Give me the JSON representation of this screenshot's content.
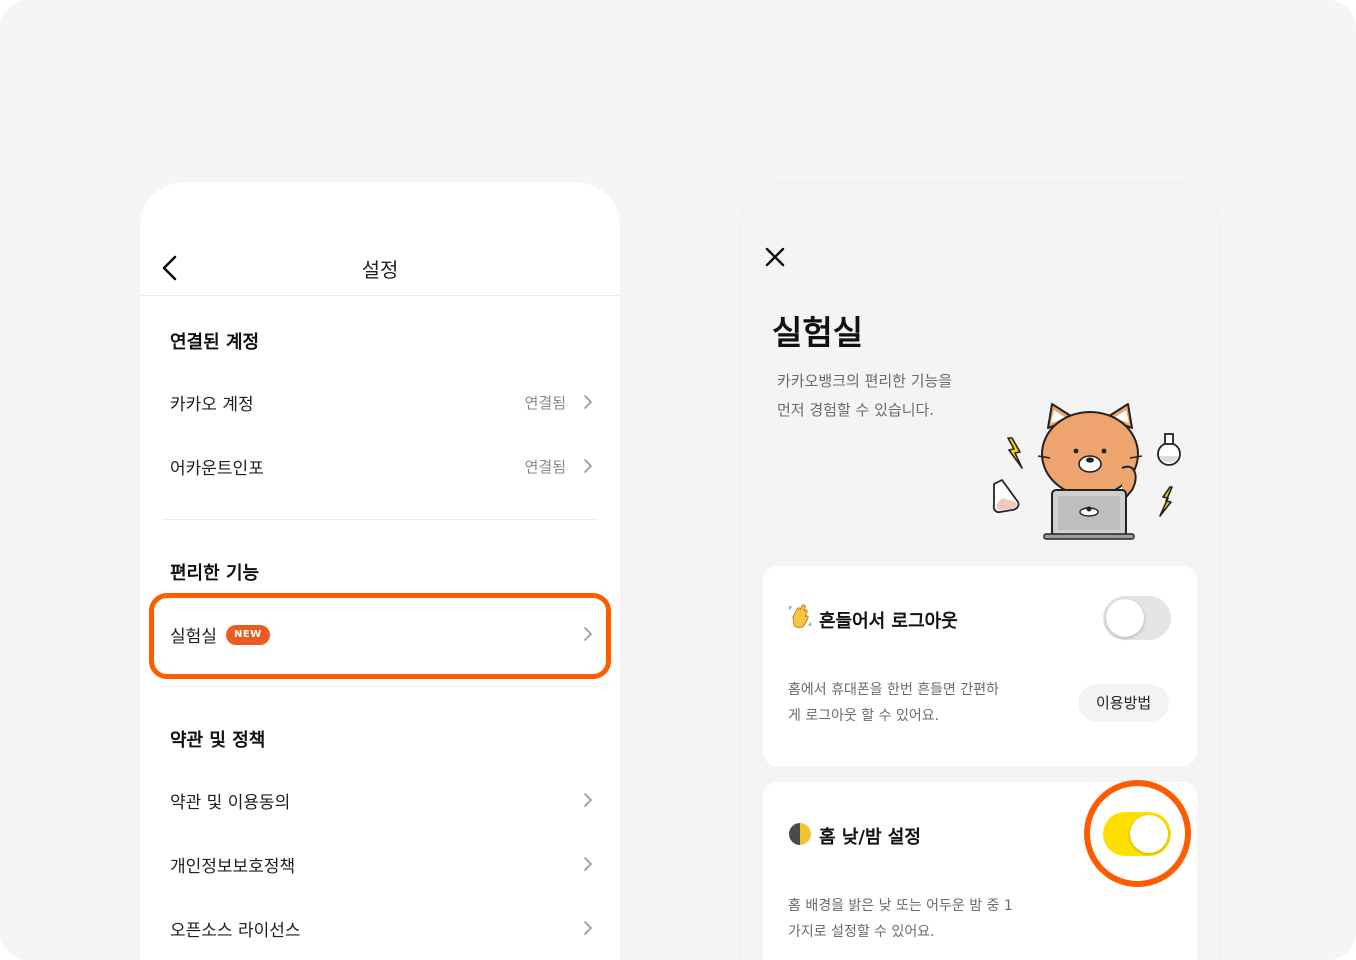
{
  "settings": {
    "nav_title": "설정",
    "sections": {
      "accounts": {
        "title": "연결된 계정",
        "items": [
          {
            "label": "카카오 계정",
            "value": "연결됨"
          },
          {
            "label": "어카운트인포",
            "value": "연결됨"
          }
        ]
      },
      "features": {
        "title": "편리한 기능",
        "items": [
          {
            "label": "실험실",
            "badge": "NEW"
          }
        ]
      },
      "policies": {
        "title": "약관 및 정책",
        "items": [
          {
            "label": "약관 및 이용동의"
          },
          {
            "label": "개인정보보호정책"
          },
          {
            "label": "오픈소스 라이선스"
          }
        ]
      }
    }
  },
  "lab": {
    "title": "실험실",
    "description_line1": "카카오뱅크의 편리한 기능을",
    "description_line2": "먼저 경험할 수 있습니다.",
    "features": [
      {
        "icon": "waving-hand-icon",
        "title": "흔들어서 로그아웃",
        "desc_line1": "홈에서 휴대폰을 한번 흔들면 간편하",
        "desc_line2": "게 로그아웃 할 수 있어요.",
        "toggle_on": false,
        "button_label": "이용방법"
      },
      {
        "icon": "half-moon-icon",
        "title": "홈 낮/밤 설정",
        "desc_line1": "홈 배경을 밝은 낮 또는 어두운 밤 중 1",
        "desc_line2": "가지로 설정할 수 있어요.",
        "toggle_on": true
      }
    ]
  },
  "colors": {
    "accent_highlight": "#ff5c00",
    "badge": "#ee5a1f",
    "toggle_on": "#fde000",
    "toggle_off": "#e4e4e4"
  }
}
